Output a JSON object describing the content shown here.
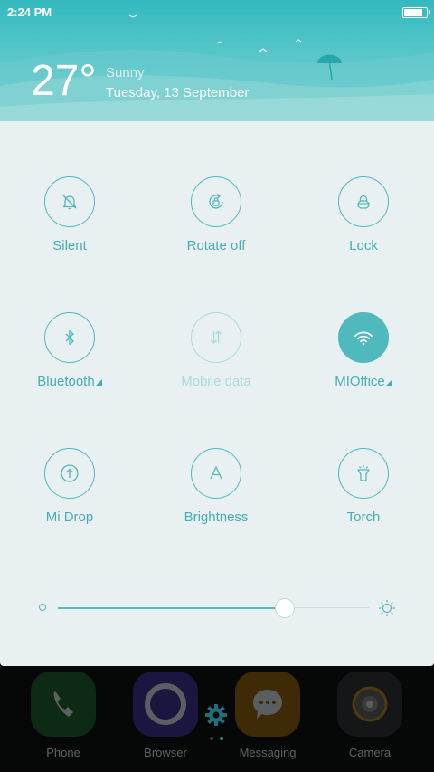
{
  "status_bar": {
    "time": "2:24 PM",
    "battery_level": 0.92
  },
  "weather": {
    "temperature": "27°",
    "condition": "Sunny",
    "date": "Tuesday, 13 September"
  },
  "toggles": [
    {
      "label": "Silent",
      "icon": "bell-off-icon",
      "state": "off"
    },
    {
      "label": "Rotate off",
      "icon": "rotate-lock-icon",
      "state": "off"
    },
    {
      "label": "Lock",
      "icon": "lock-icon",
      "state": "off"
    },
    {
      "label": "Bluetooth",
      "icon": "bluetooth-icon",
      "state": "off",
      "has_menu": true
    },
    {
      "label": "Mobile data",
      "icon": "mobile-data-icon",
      "state": "disabled"
    },
    {
      "label": "MIOffice",
      "icon": "wifi-icon",
      "state": "on",
      "has_menu": true
    },
    {
      "label": "Mi Drop",
      "icon": "upload-icon",
      "state": "off"
    },
    {
      "label": "Brightness",
      "icon": "auto-brightness-icon",
      "state": "off"
    },
    {
      "label": "Torch",
      "icon": "flashlight-icon",
      "state": "off"
    }
  ],
  "brightness": {
    "level": 0.73
  },
  "dock": {
    "apps": [
      {
        "name": "Phone",
        "icon": "phone-icon",
        "color": "#1f9c3a"
      },
      {
        "name": "Browser",
        "icon": "browser-icon",
        "color": "#5b47d6"
      },
      {
        "name": "Messaging",
        "icon": "chat-bubble-icon",
        "color": "#f3a01b"
      },
      {
        "name": "Camera",
        "icon": "camera-icon",
        "color": "#444444"
      }
    ]
  },
  "colors": {
    "accent": "#4fb9bd",
    "panel_bg": "#e9f0f2",
    "header_bg": "#46c0c4"
  }
}
